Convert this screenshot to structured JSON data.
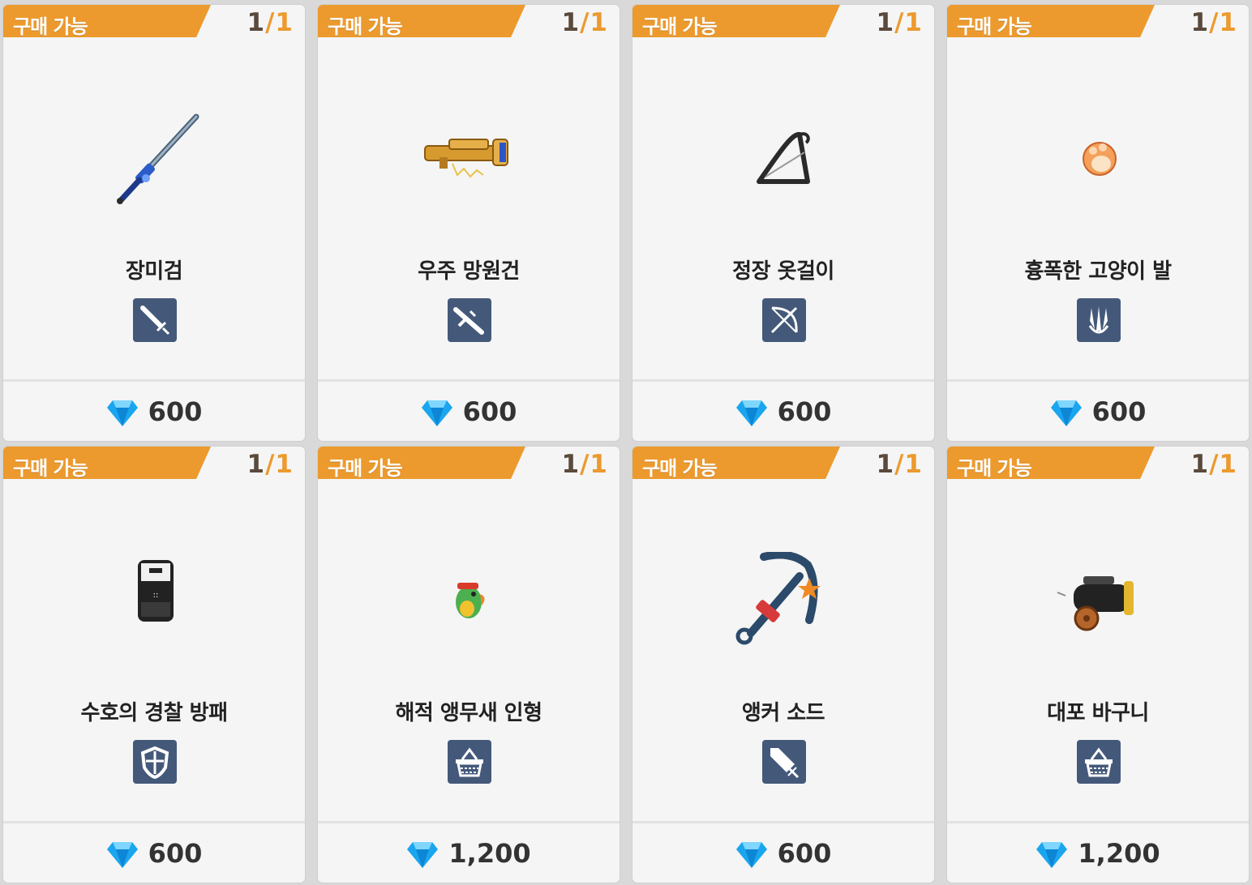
{
  "shop": {
    "cards": [
      {
        "badge": "구매 가능",
        "count_num": "1",
        "count_slash": "/",
        "count_den": "1",
        "name": "장미검",
        "type_icon": "sword-type-icon",
        "item_icon": "rose-sword-icon",
        "price": "600"
      },
      {
        "badge": "구매 가능",
        "count_num": "1",
        "count_slash": "/",
        "count_den": "1",
        "name": "우주 망원건",
        "type_icon": "gun-type-icon",
        "item_icon": "space-telescope-gun-icon",
        "price": "600"
      },
      {
        "badge": "구매 가능",
        "count_num": "1",
        "count_slash": "/",
        "count_den": "1",
        "name": "정장 옷걸이",
        "type_icon": "bow-type-icon",
        "item_icon": "suit-hanger-icon",
        "price": "600"
      },
      {
        "badge": "구매 가능",
        "count_num": "1",
        "count_slash": "/",
        "count_den": "1",
        "name": "흉폭한 고양이 발",
        "type_icon": "claw-type-icon",
        "item_icon": "cat-paw-icon",
        "price": "600"
      },
      {
        "badge": "구매 가능",
        "count_num": "1",
        "count_slash": "/",
        "count_den": "1",
        "name": "수호의 경찰 방패",
        "type_icon": "shield-type-icon",
        "item_icon": "police-shield-icon",
        "price": "600"
      },
      {
        "badge": "구매 가능",
        "count_num": "1",
        "count_slash": "/",
        "count_den": "1",
        "name": "해적 앵무새 인형",
        "type_icon": "basket-type-icon",
        "item_icon": "pirate-parrot-doll-icon",
        "price": "1,200"
      },
      {
        "badge": "구매 가능",
        "count_num": "1",
        "count_slash": "/",
        "count_den": "1",
        "name": "앵커 소드",
        "type_icon": "greatsword-type-icon",
        "item_icon": "anchor-sword-icon",
        "price": "600"
      },
      {
        "badge": "구매 가능",
        "count_num": "1",
        "count_slash": "/",
        "count_den": "1",
        "name": "대포 바구니",
        "type_icon": "basket-type-icon",
        "item_icon": "cannon-basket-icon",
        "price": "1,200"
      }
    ],
    "currency_icon": "blue-gem-icon",
    "colors": {
      "badge": "#ec9a2e",
      "type_icon_bg": "#44597a",
      "gem": "#1aa6ee"
    }
  }
}
